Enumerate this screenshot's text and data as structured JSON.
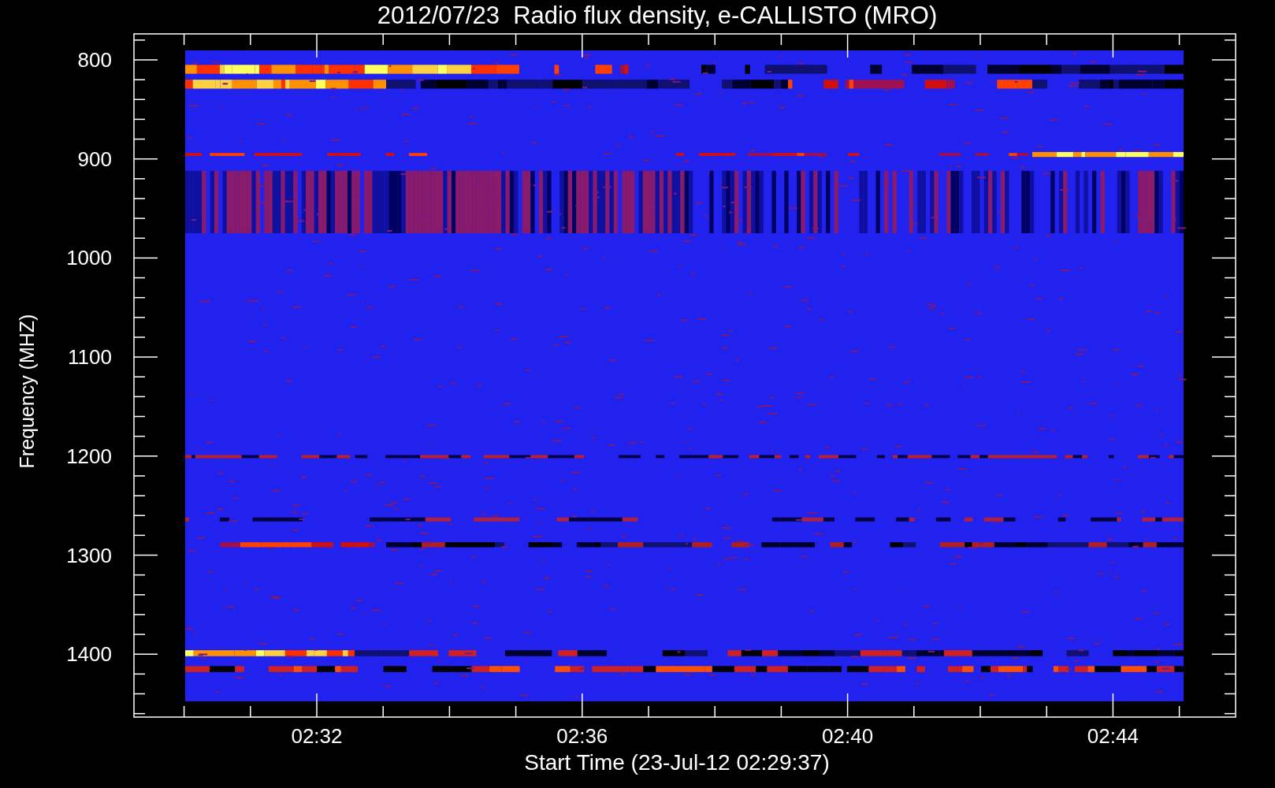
{
  "title": "2012/07/23  Radio flux density, e-CALLISTO (MRO)",
  "y_axis": {
    "label": "Frequency (MHZ)",
    "ticks": [
      "800",
      "900",
      "1000",
      "1100",
      "1200",
      "1300",
      "1400"
    ]
  },
  "x_axis": {
    "label": "Start Time (23-Jul-12 02:29:37)",
    "ticks": [
      "02:32",
      "02:36",
      "02:40",
      "02:44"
    ]
  }
}
